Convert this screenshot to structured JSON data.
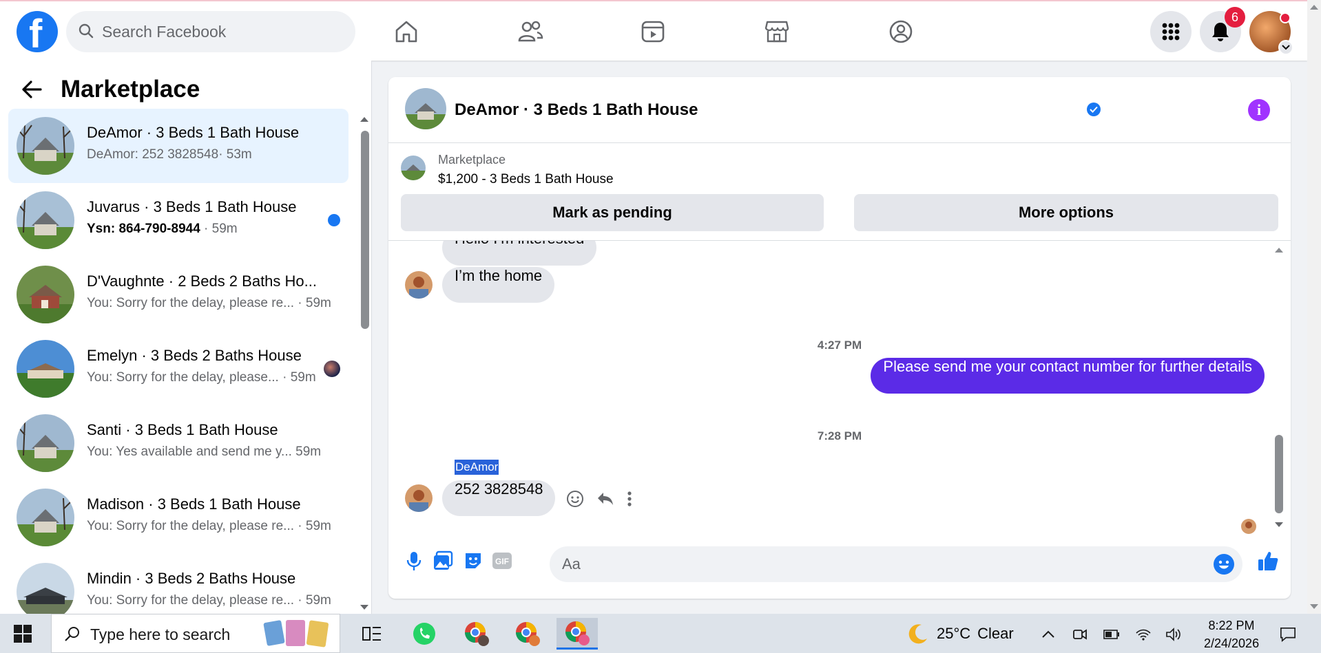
{
  "topbar": {
    "search_placeholder": "Search Facebook",
    "notifications_count": "6",
    "nav": [
      "home-icon",
      "friends-icon",
      "watch-icon",
      "marketplace-icon",
      "groups-icon"
    ]
  },
  "sidebar": {
    "title": "Marketplace",
    "conversations": [
      {
        "title": "DeAmor · 3 Beds 1 Bath House",
        "preview": "DeAmor: 252 3828548",
        "time": "· 53m",
        "active": true
      },
      {
        "title": "Juvarus · 3 Beds 1 Bath House",
        "preview": "Ysn: 864-790-8944",
        "time": " · 59m",
        "unread": true
      },
      {
        "title": "D'Vaughnte · 2 Beds 2 Baths Ho...",
        "preview": "You: Sorry for the delay, please re...",
        "time": " · 59m"
      },
      {
        "title": "Emelyn · 3 Beds 2 Baths House",
        "preview": "You: Sorry for the delay, please...",
        "time": " · 59m"
      },
      {
        "title": "Santi · 3 Beds 1 Bath House",
        "preview": "You: Yes available and send me y...",
        "time": "  59m"
      },
      {
        "title": "Madison · 3 Beds 1 Bath House",
        "preview": "You: Sorry for the delay, please re...",
        "time": " · 59m"
      },
      {
        "title": "Mindin · 3 Beds 2 Baths House",
        "preview": "You: Sorry for the delay, please re...",
        "time": " · 59m"
      }
    ]
  },
  "chat": {
    "title": "DeAmor · 3 Beds 1 Bath House",
    "listing_category": "Marketplace",
    "listing_price": "$1,200 - 3 Beds 1 Bath House",
    "mark_pending": "Mark as pending",
    "more_options": "More options",
    "messages": {
      "in1": "Hello I’m interested",
      "in2": "I’m the home",
      "time1": "4:27 PM",
      "out1": "Please send me your contact number for further details",
      "time2": "7:28 PM",
      "sender": "DeAmor",
      "in3": "252 3828548"
    },
    "composer_placeholder": "Aa"
  },
  "taskbar": {
    "search_placeholder": "Type here to search",
    "temperature": "25°C",
    "weather": "Clear",
    "time": "8:22 PM",
    "date": "2/24/2026"
  },
  "colors": {
    "brand": "#1877f2",
    "outgoing_bubble": "#5b2be7",
    "active_row": "#e7f3ff"
  }
}
